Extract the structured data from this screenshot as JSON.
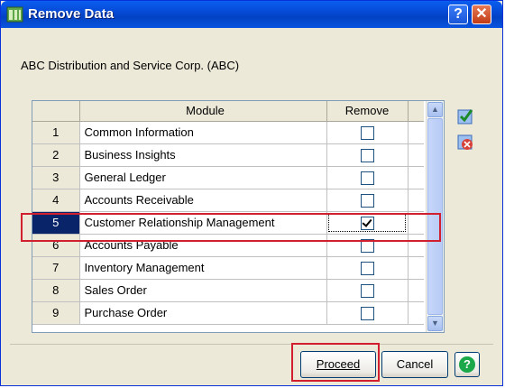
{
  "window": {
    "title": "Remove Data",
    "help_glyph": "?",
    "close_glyph": "✕"
  },
  "company": "ABC Distribution and Service Corp. (ABC)",
  "grid": {
    "headers": {
      "module": "Module",
      "remove": "Remove"
    },
    "rows": [
      {
        "num": "1",
        "module": "Common Information",
        "remove": false
      },
      {
        "num": "2",
        "module": "Business Insights",
        "remove": false
      },
      {
        "num": "3",
        "module": "General Ledger",
        "remove": false
      },
      {
        "num": "4",
        "module": "Accounts Receivable",
        "remove": false
      },
      {
        "num": "5",
        "module": "Customer Relationship Management",
        "remove": true
      },
      {
        "num": "6",
        "module": "Accounts Payable",
        "remove": false
      },
      {
        "num": "7",
        "module": "Inventory Management",
        "remove": false
      },
      {
        "num": "8",
        "module": "Sales Order",
        "remove": false
      },
      {
        "num": "9",
        "module": "Purchase Order",
        "remove": false
      }
    ],
    "selected_row": "5"
  },
  "side_icons": [
    "check-all-icon",
    "uncheck-all-icon"
  ],
  "buttons": {
    "proceed": "Proceed",
    "cancel": "Cancel",
    "help": "?"
  },
  "colors": {
    "selection": "#0a246a",
    "annotation": "#d21f2f",
    "title_bar": "#0548d2"
  }
}
